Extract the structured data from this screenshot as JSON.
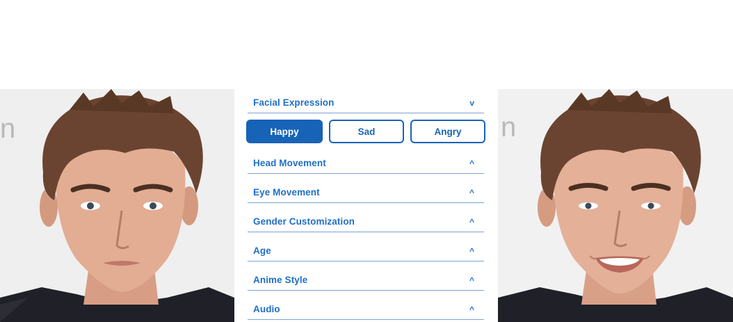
{
  "panel": {
    "expanded_section": {
      "label": "Facial Expression",
      "caret": "v",
      "options": [
        {
          "label": "Happy",
          "selected": true
        },
        {
          "label": "Sad",
          "selected": false
        },
        {
          "label": "Angry",
          "selected": false
        }
      ]
    },
    "sections": [
      {
        "label": "Head Movement",
        "caret": "^"
      },
      {
        "label": "Eye Movement",
        "caret": "^"
      },
      {
        "label": "Gender Customization",
        "caret": "^"
      },
      {
        "label": "Age",
        "caret": "^"
      },
      {
        "label": "Anime Style",
        "caret": "^"
      },
      {
        "label": "Audio",
        "caret": "^"
      }
    ]
  },
  "photos": {
    "left": {
      "background_text": "n"
    },
    "right": {
      "background_text": "n"
    }
  },
  "colors": {
    "accent": "#1763b8",
    "label": "#1f6fc7",
    "divider": "#7aa3d6"
  }
}
